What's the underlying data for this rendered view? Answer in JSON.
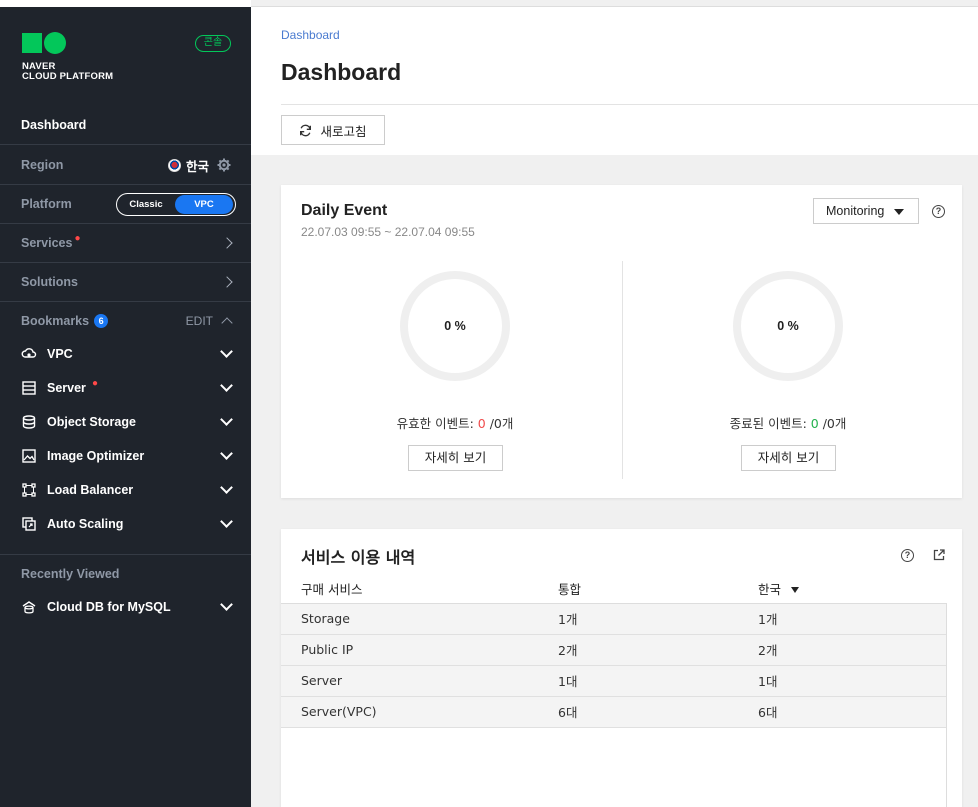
{
  "sidebar": {
    "brand_line1": "NAVER",
    "brand_line2": "CLOUD PLATFORM",
    "console_badge": "콘솔",
    "dashboard_label": "Dashboard",
    "region_label": "Region",
    "region_value": "한국",
    "platform_label": "Platform",
    "platform_options": [
      "Classic",
      "VPC"
    ],
    "platform_selected": "VPC",
    "services_label": "Services",
    "solutions_label": "Solutions",
    "bookmarks_label": "Bookmarks",
    "bookmarks_count": "6",
    "bookmarks_edit": "EDIT",
    "bookmarks": [
      {
        "label": "VPC",
        "icon": "vpc-icon"
      },
      {
        "label": "Server",
        "icon": "server-icon"
      },
      {
        "label": "Object Storage",
        "icon": "object-storage-icon"
      },
      {
        "label": "Image Optimizer",
        "icon": "image-optimizer-icon"
      },
      {
        "label": "Load Balancer",
        "icon": "load-balancer-icon"
      },
      {
        "label": "Auto Scaling",
        "icon": "auto-scaling-icon"
      }
    ],
    "recently_viewed_label": "Recently Viewed",
    "recent": [
      {
        "label": "Cloud DB for MySQL",
        "icon": "cloud-db-icon"
      }
    ]
  },
  "header": {
    "breadcrumb": "Dashboard",
    "title": "Dashboard",
    "refresh_label": "새로고침"
  },
  "daily_event": {
    "title": "Daily Event",
    "date_range": "22.07.03 09:55 ~ 22.07.04 09:55",
    "filter_value": "Monitoring",
    "left": {
      "percent": "0 %",
      "label_prefix": "유효한 이벤트: ",
      "count": "0",
      "label_suffix": " /0개",
      "button": "자세히 보기"
    },
    "right": {
      "percent": "0 %",
      "label_prefix": "종료된 이벤트: ",
      "count": "0",
      "label_suffix": " /0개",
      "button": "자세히 보기"
    }
  },
  "usage": {
    "title": "서비스 이용 내역",
    "columns": [
      "구매 서비스",
      "통합",
      "한국"
    ],
    "rows": [
      [
        "Storage",
        "1개",
        "1개"
      ],
      [
        "Public IP",
        "2개",
        "2개"
      ],
      [
        "Server",
        "1대",
        "1대"
      ],
      [
        "Server(VPC)",
        "6대",
        "6대"
      ]
    ]
  },
  "colors": {
    "sidebar_bg": "#1f242c",
    "brand_green": "#03c75a",
    "accent_blue": "#1a77f2",
    "alert_red": "#f04b4b",
    "ok_green": "#22b14c"
  }
}
